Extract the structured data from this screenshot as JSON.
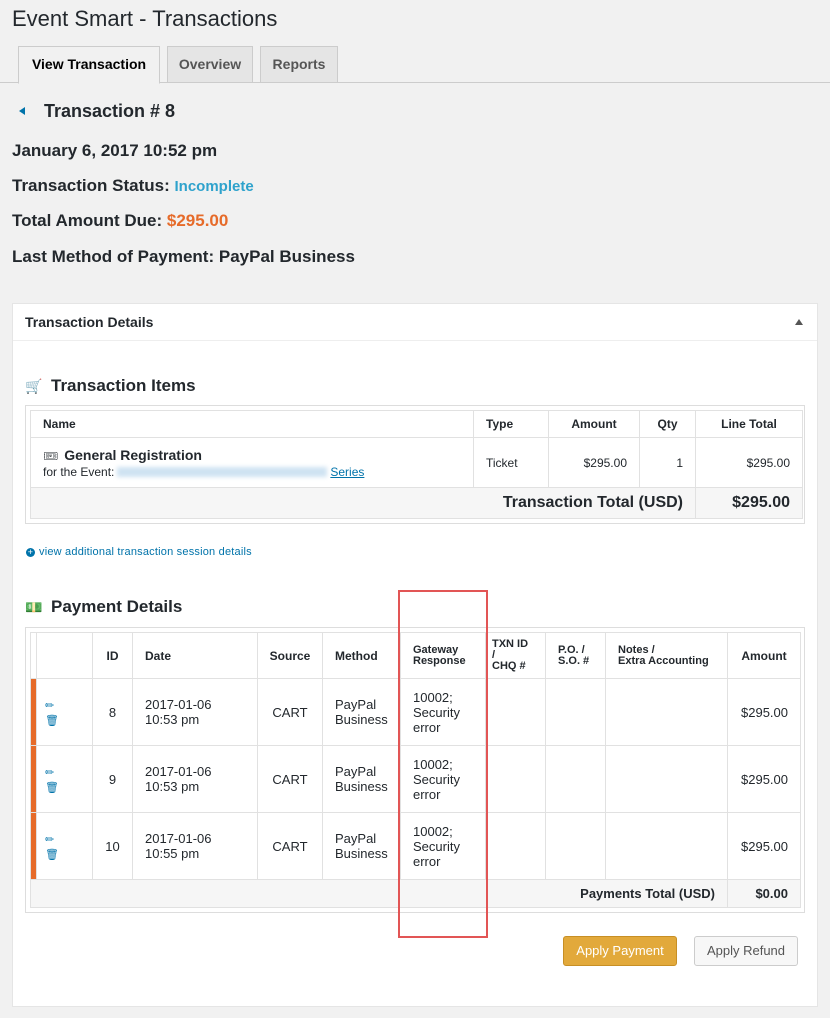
{
  "page": {
    "title": "Event Smart - Transactions"
  },
  "tabs": [
    {
      "label": "View Transaction"
    },
    {
      "label": "Overview"
    },
    {
      "label": "Reports"
    }
  ],
  "transaction": {
    "title": "Transaction # 8",
    "date": "January 6, 2017 10:52 pm",
    "status_label": "Transaction Status:",
    "status_value": "Incomplete",
    "due_label": "Total Amount Due:",
    "due_value": "$295.00",
    "method_label": "Last Method of Payment:",
    "method_value": "PayPal Business"
  },
  "details_panel": {
    "title": "Transaction Details"
  },
  "items_section": {
    "title": "Transaction Items",
    "headers": [
      "Name",
      "Type",
      "Amount",
      "Qty",
      "Line Total"
    ],
    "rows": [
      {
        "name": "General Registration",
        "event_prefix": "for the Event:",
        "event_suffix": "Series",
        "type": "Ticket",
        "amount": "$295.00",
        "qty": "1",
        "line_total": "$295.00"
      }
    ],
    "total_label": "Transaction Total (USD)",
    "total_value": "$295.00"
  },
  "session_link": "view additional transaction session details",
  "payments_section": {
    "title": "Payment Details",
    "headers": {
      "id": "ID",
      "date": "Date",
      "source": "Source",
      "method": "Method",
      "gateway_1": "Gateway",
      "gateway_2": "Response",
      "txn_1": "TXN ID",
      "txn_2": "/",
      "txn_3": "CHQ #",
      "po_1": "P.O. /",
      "po_2": "S.O. #",
      "notes_1": "Notes /",
      "notes_2": "Extra Accounting",
      "amount": "Amount"
    },
    "rows": [
      {
        "id": "8",
        "date_1": "2017-01-06",
        "date_2": "10:53 pm",
        "source": "CART",
        "method_1": "PayPal",
        "method_2": "Business",
        "resp_1": "10002;",
        "resp_2": "Security",
        "resp_3": "error",
        "amount": "$295.00"
      },
      {
        "id": "9",
        "date_1": "2017-01-06",
        "date_2": "10:53 pm",
        "source": "CART",
        "method_1": "PayPal",
        "method_2": "Business",
        "resp_1": "10002;",
        "resp_2": "Security",
        "resp_3": "error",
        "amount": "$295.00"
      },
      {
        "id": "10",
        "date_1": "2017-01-06",
        "date_2": "10:55 pm",
        "source": "CART",
        "method_1": "PayPal",
        "method_2": "Business",
        "resp_1": "10002;",
        "resp_2": "Security",
        "resp_3": "error",
        "amount": "$295.00"
      }
    ],
    "total_label": "Payments Total (USD)",
    "total_value": "$0.00"
  },
  "buttons": {
    "apply_payment": "Apply Payment",
    "apply_refund": "Apply Refund"
  },
  "colors": {
    "accent": "#0073aa",
    "status": "#2ea2cc",
    "due": "#e66b2a",
    "primary_button": "#e2a93b",
    "highlight": "#e25555"
  }
}
